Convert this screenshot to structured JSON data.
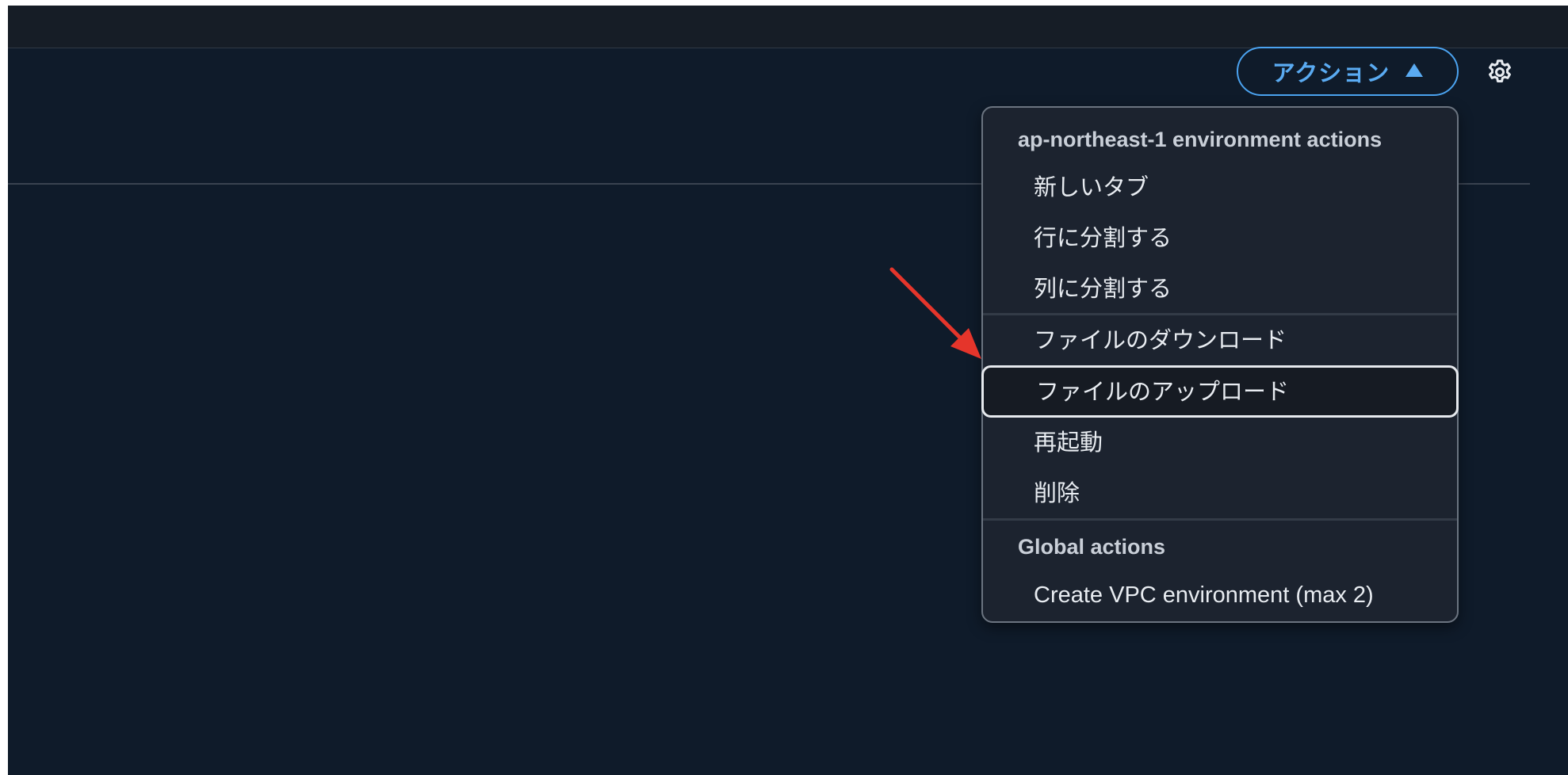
{
  "toolbar": {
    "actions_label": "アクション",
    "actions_caret_icon": "caret-up-icon",
    "settings_icon": "gear-icon"
  },
  "menu": {
    "group1_header": "ap-northeast-1 environment actions",
    "items": [
      {
        "label": "新しいタブ"
      },
      {
        "label": "行に分割する"
      },
      {
        "label": "列に分割する"
      },
      {
        "label": "ファイルのダウンロード"
      },
      {
        "label": "ファイルのアップロード",
        "highlighted": true
      },
      {
        "label": "再起動"
      },
      {
        "label": "削除"
      }
    ],
    "group2_header": "Global actions",
    "global_items": [
      {
        "label": "Create VPC environment (max 2)"
      }
    ]
  },
  "annotation": {
    "arrow_color": "#e5352b",
    "arrow_icon": "red-arrow-annotation"
  },
  "colors": {
    "background": "#0f1b2a",
    "accent": "#4ba3f0",
    "menu_background": "#1c232f"
  }
}
